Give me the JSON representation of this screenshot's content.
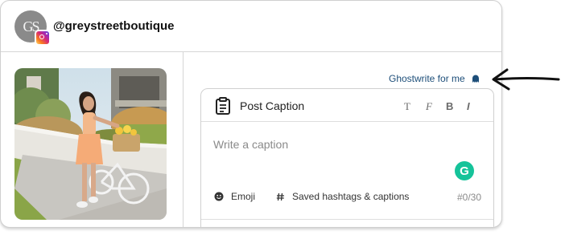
{
  "account": {
    "avatar_initials": "GS",
    "username": "@greystreetboutique",
    "platform_icon": "instagram-icon"
  },
  "ghostwrite": {
    "label": "Ghostwrite for me",
    "icon": "ghost-icon"
  },
  "caption_panel": {
    "title": "Post Caption",
    "title_icon": "clipboard-icon",
    "format_buttons": [
      "T",
      "F",
      "B",
      "I"
    ],
    "placeholder": "Write a caption",
    "value": "",
    "grammarly_label": "G",
    "emoji_label": "Emoji",
    "hashtags_label": "Saved hashtags & captions",
    "char_counter": "#0/30"
  },
  "colors": {
    "accent_link": "#1d4e79",
    "grammarly": "#15c39a",
    "border": "#d0d0d0"
  }
}
